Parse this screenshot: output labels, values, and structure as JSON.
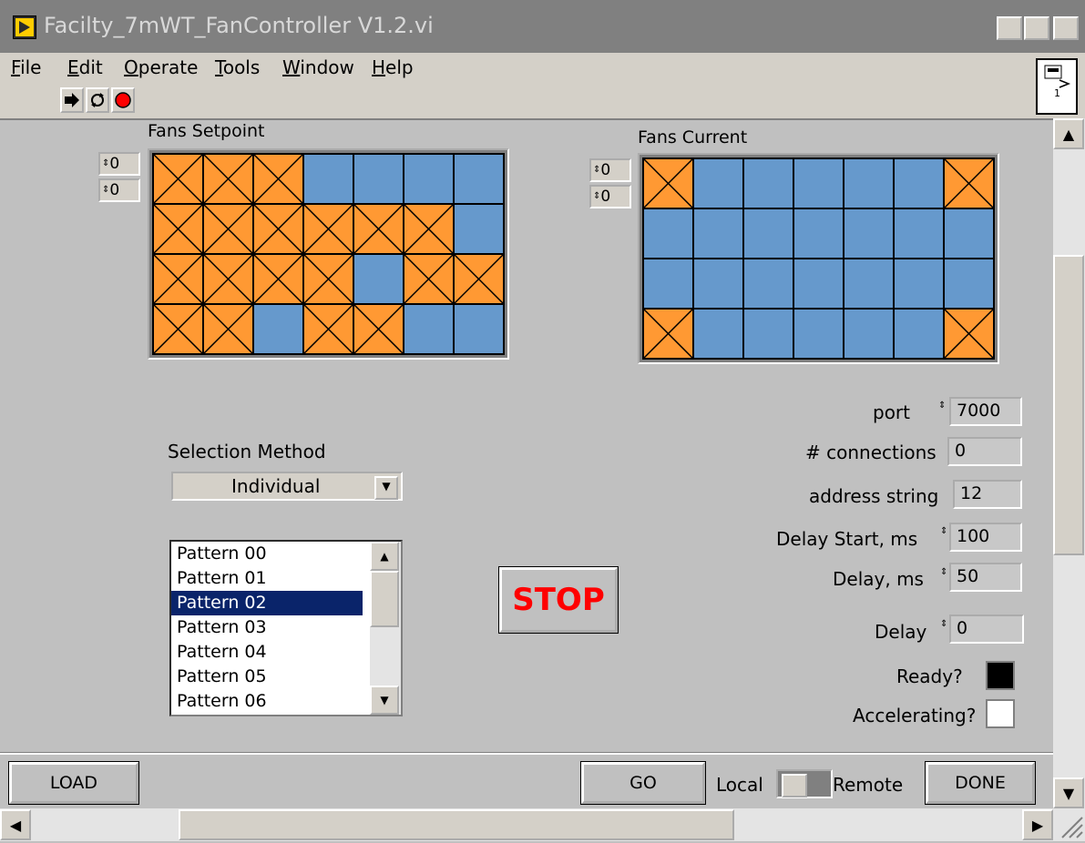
{
  "window": {
    "title": "Facilty_7mWT_FanController V1.2.vi",
    "caption_buttons": [
      "_",
      "□",
      "×"
    ]
  },
  "menu": [
    "File",
    "Edit",
    "Operate",
    "Tools",
    "Window",
    "Help"
  ],
  "toolbar": {
    "icons": [
      "run-arrow-icon",
      "run-continuously-icon",
      "abort-execution-icon"
    ]
  },
  "fans_setpoint": {
    "label": "Fans Setpoint",
    "row_index": "0",
    "col_index": "0",
    "grid": [
      [
        1,
        1,
        1,
        0,
        0,
        0,
        0
      ],
      [
        1,
        1,
        1,
        1,
        1,
        1,
        0
      ],
      [
        1,
        1,
        1,
        1,
        0,
        1,
        1
      ],
      [
        1,
        1,
        0,
        1,
        1,
        0,
        0
      ]
    ]
  },
  "fans_current": {
    "label": "Fans Current",
    "row_index": "0",
    "col_index": "0",
    "grid": [
      [
        1,
        0,
        0,
        0,
        0,
        0,
        1
      ],
      [
        0,
        0,
        0,
        0,
        0,
        0,
        0
      ],
      [
        0,
        0,
        0,
        0,
        0,
        0,
        0
      ],
      [
        1,
        0,
        0,
        0,
        0,
        0,
        1
      ]
    ]
  },
  "selection_method": {
    "label": "Selection Method",
    "value": "Individual"
  },
  "patterns": {
    "items": [
      "Pattern 00",
      "Pattern 01",
      "Pattern 02",
      "Pattern 03",
      "Pattern 04",
      "Pattern 05",
      "Pattern 06"
    ],
    "selected": "Pattern 02"
  },
  "stop_label": "STOP",
  "port": {
    "label": "port",
    "value": "7000"
  },
  "connections": {
    "label": "# connections",
    "value": "0"
  },
  "address_string": {
    "label": "address string",
    "value": "12"
  },
  "delay_start": {
    "label": "Delay Start, ms",
    "value": "100"
  },
  "delay_ms": {
    "label": "Delay, ms",
    "value": "50"
  },
  "delay": {
    "label": "Delay",
    "value": "0"
  },
  "ready": {
    "label": "Ready?",
    "color": "#000000"
  },
  "accelerating": {
    "label": "Accelerating?",
    "color": "#ffffff"
  },
  "buttons": {
    "load": "LOAD",
    "go": "GO",
    "done": "DONE"
  },
  "mode_switch": {
    "left_label": "Local",
    "right_label": "Remote"
  },
  "colors": {
    "fan_on": "#ff9933",
    "fan_off": "#6699cc",
    "stop_text": "#ff0000",
    "selected_row": "#0a246a"
  }
}
